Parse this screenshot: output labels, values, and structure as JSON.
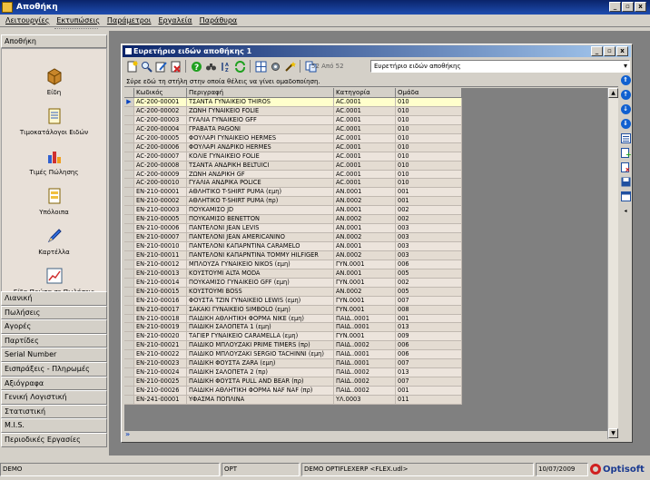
{
  "app": {
    "title": "Αποθήκη"
  },
  "window_buttons": [
    "_",
    "▫",
    "x"
  ],
  "menu": [
    "Λειτουργίες",
    "Εκτυπώσεις",
    "Παράμετροι",
    "Εργαλεία",
    "Παράθυρα"
  ],
  "sidebar": {
    "header": "Αποθήκη",
    "items": [
      {
        "label": "Είδη",
        "icon": "box-icon"
      },
      {
        "label": "Τιμοκατάλογοι Ειδών",
        "icon": "price-list-icon"
      },
      {
        "label": "Τιμές Πώλησης",
        "icon": "sales-chart-icon"
      },
      {
        "label": "Υπόλοιπα",
        "icon": "document-icon"
      },
      {
        "label": "Καρτέλλα",
        "icon": "pencil-icon"
      },
      {
        "label": "Είδη Πρώτα σε Πωλήσεις",
        "icon": "line-chart-icon"
      }
    ],
    "modules": [
      "Λιανική",
      "Πωλήσεις",
      "Αγορές",
      "Παρτίδες",
      "Serial Number",
      "Εισπράξεις - Πληρωμές",
      "Αξιόγραφα",
      "Γενική Λογιστική",
      "Στατιστική",
      "M.I.S.",
      "Περιοδικές Εργασίες"
    ]
  },
  "child_window": {
    "title": "Ευρετήριο ειδών αποθήκης 1",
    "counter": "52 Από 52",
    "combo_value": "Ευρετήριο ειδών αποθήκης",
    "group_hint": "Σύρε εδώ τη στήλη στην οποία θέλεις να γίνει ομαδοποίηση.",
    "columns": [
      "Κωδικός",
      "Περιγραφή",
      "Κατηγορία",
      "Ομάδα"
    ],
    "rows": [
      [
        "AC-200-00001",
        "ΤΣΑΝΤΑ ΓΥΝΑΙΚΕΙΟ THIROS",
        "AC.0001",
        "010"
      ],
      [
        "AC-200-00002",
        "ΖΩΝΗ ΓΥΝΑΙΚΕΙΟ FOLIE",
        "AC.0001",
        "010"
      ],
      [
        "AC-200-00003",
        "ΓΥΑΛΙΑ ΓΥΝΑΙΚΕΙΟ GFF",
        "AC.0001",
        "010"
      ],
      [
        "AC-200-00004",
        "ΓΡΑΒΑΤΑ PAGONI",
        "AC.0001",
        "010"
      ],
      [
        "AC-200-00005",
        "ΦΟΥΛΑΡΙ ΓΥΝΑΙΚΕΙΟ HERMES",
        "AC.0001",
        "010"
      ],
      [
        "AC-200-00006",
        "ΦΟΥΛΑΡΙ ΑΝΔΡΙΚΟ HERMES",
        "AC.0001",
        "010"
      ],
      [
        "AC-200-00007",
        "ΚΟΛΙΕ ΓΥΝΑΙΚΕΙΟ FOLIE",
        "AC.0001",
        "010"
      ],
      [
        "AC-200-00008",
        "ΤΣΑΝΤΑ ΑΝΔΡΙΚΗ BELTUICI",
        "AC.0001",
        "010"
      ],
      [
        "AC-200-00009",
        "ΖΩΝΗ ΑΝΔΡΙΚΗ GF",
        "AC.0001",
        "010"
      ],
      [
        "AC-200-00010",
        "ΓΥΑΛΙΑ ΑΝΔΡΙΚΑ POLICE",
        "AC.0001",
        "010"
      ],
      [
        "EN-210-00001",
        "ΑΘΛΗΤΙΚΟ T-SHIRT PUMA (εμη)",
        "AN.0001",
        "001"
      ],
      [
        "EN-210-00002",
        "ΑΘΛΗΤΙΚΟ T-SHIRT PUMA (πρ)",
        "AN.0002",
        "001"
      ],
      [
        "EN-210-00003",
        "ΠΟΥΚΑΜΙΣΟ JD",
        "AN.0001",
        "002"
      ],
      [
        "EN-210-00005",
        "ΠΟΥΚΑΜΙΣΟ BENETTON",
        "AN.0002",
        "002"
      ],
      [
        "EN-210-00006",
        "ΠΑΝΤΕΛΟΝΙ JEAN LEVIS",
        "AN.0001",
        "003"
      ],
      [
        "EN-210-00007",
        "ΠΑΝΤΕΛΟΝΙ JEAN AMERICANINO",
        "AN.0002",
        "003"
      ],
      [
        "EN-210-00010",
        "ΠΑΝΤΕΛΟΝΙ ΚΑΠΑΡΝΤΙΝΑ CARAMELO",
        "AN.0001",
        "003"
      ],
      [
        "EN-210-00011",
        "ΠΑΝΤΕΛΟΝΙ ΚΑΠΑΡΝΤΙΝΑ TOMMY HILFIGER",
        "AN.0002",
        "003"
      ],
      [
        "EN-210-00012",
        "ΜΠΛΟΥΖΑ ΓΥΝΑΙΚΕΙΟ NIKOS (εμη)",
        "ΓΥΝ.0001",
        "006"
      ],
      [
        "EN-210-00013",
        "ΚΟΥΣΤΟΥΜΙ ALTA MODA",
        "AN.0001",
        "005"
      ],
      [
        "EN-210-00014",
        "ΠΟΥΚΑΜΙΣΟ ΓΥΝΑΙΚΕΙΟ GFF (εμη)",
        "ΓΥΝ.0001",
        "002"
      ],
      [
        "EN-210-00015",
        "ΚΟΥΣΤΟΥΜΙ BOSS",
        "AN.0002",
        "005"
      ],
      [
        "EN-210-00016",
        "ΦΟΥΣΤΑ ΤΖΙΝ ΓΥΝΑΙΚΕΙΟ LEWIS (εμη)",
        "ΓΥΝ.0001",
        "007"
      ],
      [
        "EN-210-00017",
        "ΣΑΚΑΚΙ ΓΥΝΑΙΚΕΙΟ SIMBOLO (εμη)",
        "ΓΥΝ.0001",
        "008"
      ],
      [
        "EN-210-00018",
        "ΠΑΙΔΙΚΗ ΑΘΛΗΤΙΚΗ ΦΟΡΜΑ NIKE (εμη)",
        "ΠΑΙΔ..0001",
        "001"
      ],
      [
        "EN-210-00019",
        "ΠΑΙΔΙΚΗ ΣΑΛΟΠΕΤΑ 1 (εμη)",
        "ΠΑΙΔ..0001",
        "013"
      ],
      [
        "EN-210-00020",
        "ΤΑΓΙΕΡ ΓΥΝΑΙΚΕΙΟ CARAMELLA (εμη)",
        "ΓΥΝ.0001",
        "009"
      ],
      [
        "EN-210-00021",
        "ΠΑΙΔΙΚΟ ΜΠΛΟΥΖΑΚΙ PRIME TIMERS (πρ)",
        "ΠΑΙΔ..0002",
        "006"
      ],
      [
        "EN-210-00022",
        "ΠΑΙΔΙΚΟ ΜΠΛΟΥΖΑΚΙ SERGIO TACHINNI (εμη)",
        "ΠΑΙΔ..0001",
        "006"
      ],
      [
        "EN-210-00023",
        "ΠΑΙΔΙΚΗ ΦΟΥΣΤΑ ZARA (εμη)",
        "ΠΑΙΔ..0001",
        "007"
      ],
      [
        "EN-210-00024",
        "ΠΑΙΔΙΚΗ ΣΑΛΟΠΕΤΑ 2 (πρ)",
        "ΠΑΙΔ..0002",
        "013"
      ],
      [
        "EN-210-00025",
        "ΠΑΙΔΙΚΗ ΦΟΥΣΤΑ PULL AND BEAR (πρ)",
        "ΠΑΙΔ..0002",
        "007"
      ],
      [
        "EN-210-00026",
        "ΠΑΙΔΙΚΗ ΑΘΛΗΤΙΚΗ ΦΟΡΜΑ NAF NAF (πρ)",
        "ΠΑΙΔ..0002",
        "001"
      ],
      [
        "EN-241-00001",
        "ΥΦΑΣΜΑ ΠΟΠΛΙΝΑ",
        "ΥΛ.0003",
        "011"
      ]
    ]
  },
  "status": {
    "left": "DEMO",
    "module": "OPT",
    "db": "DEMO OPTIFLEXERP <FLEX.udl>",
    "date": "10/07/2009",
    "brand": "Optisoft"
  },
  "colors": {
    "title_blue": "#0a246a",
    "selected_row": "#ffffcc",
    "brand_red": "#d02020"
  }
}
